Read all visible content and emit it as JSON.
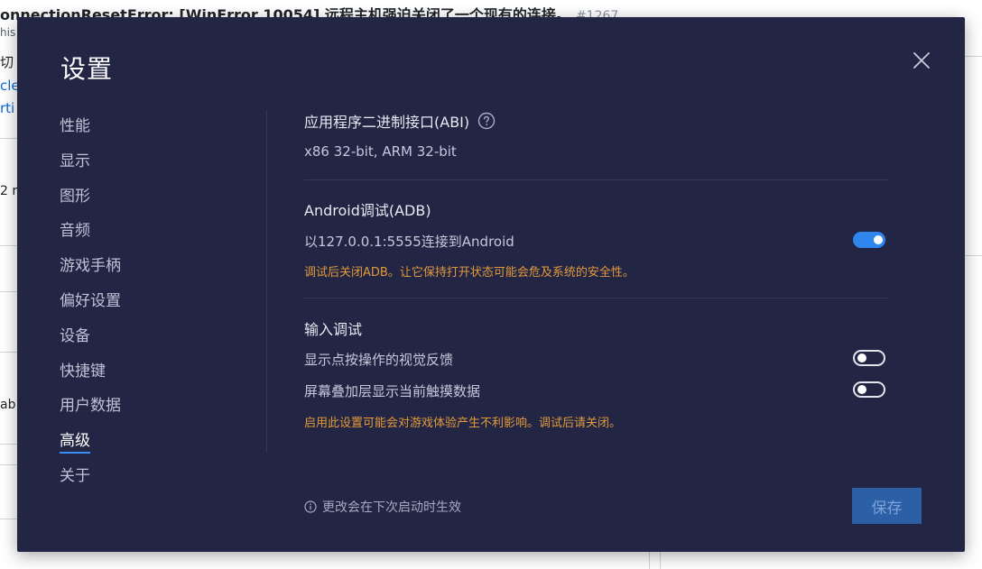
{
  "background": {
    "issue_title": "onnectionResetError: [WinError 10054] 远程主机强迫关闭了一个现有的连接。",
    "issue_number": "#1267",
    "subtitle": "his",
    "fragments": [
      "切",
      "cle/",
      "rti",
      "2 r",
      "ab"
    ]
  },
  "dialog": {
    "title": "设置",
    "close_icon": "close-icon",
    "nav": [
      {
        "label": "性能"
      },
      {
        "label": "显示"
      },
      {
        "label": "图形"
      },
      {
        "label": "音频"
      },
      {
        "label": "游戏手柄"
      },
      {
        "label": "偏好设置"
      },
      {
        "label": "设备"
      },
      {
        "label": "快捷键"
      },
      {
        "label": "用户数据"
      },
      {
        "label": "高级",
        "active": true
      },
      {
        "label": "关于"
      }
    ],
    "abi": {
      "heading": "应用程序二进制接口(ABI)",
      "help_icon": "help-circle-icon",
      "value": "x86 32-bit, ARM 32-bit"
    },
    "adb": {
      "heading": "Android调试(ADB)",
      "connect_label": "以127.0.0.1:5555连接到Android",
      "enabled": true,
      "warning": "调试后关闭ADB。让它保持打开状态可能会危及系统的安全性。"
    },
    "input_debug": {
      "heading": "输入调试",
      "items": [
        {
          "label": "显示点按操作的视觉反馈",
          "enabled": false
        },
        {
          "label": "屏幕叠加层显示当前触摸数据",
          "enabled": false
        }
      ],
      "warning": "启用此设置可能会对游戏体验产生不利影响。调试后请关闭。"
    },
    "footer_note": "更改会在下次启动时生效",
    "footer_icon": "info-icon",
    "save_label": "保存",
    "colors": {
      "dialog_bg": "#222543",
      "accent": "#2f86ef",
      "warning": "#e29a3c",
      "save_button": "#2b5fa6"
    }
  }
}
